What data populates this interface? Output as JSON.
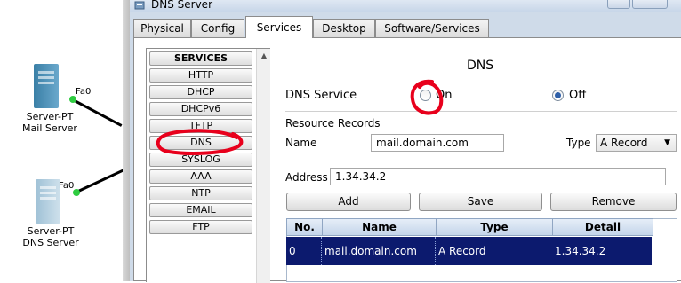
{
  "topology": {
    "nodes": [
      {
        "type_label": "Server-PT",
        "name_label": "Mail Server",
        "port": "Fa0",
        "color": "#4a8fb5"
      },
      {
        "type_label": "Server-PT",
        "name_label": "DNS Server",
        "port": "Fa0",
        "color": "#a9c8dc"
      }
    ]
  },
  "window": {
    "title": "DNS Server",
    "tabs": [
      {
        "label": "Physical",
        "active": false
      },
      {
        "label": "Config",
        "active": false
      },
      {
        "label": "Services",
        "active": true
      },
      {
        "label": "Desktop",
        "active": false
      },
      {
        "label": "Software/Services",
        "active": false
      }
    ]
  },
  "services": {
    "header": "SERVICES",
    "items": [
      "HTTP",
      "DHCP",
      "DHCPv6",
      "TFTP",
      "DNS",
      "SYSLOG",
      "AAA",
      "NTP",
      "EMAIL",
      "FTP"
    ],
    "selected": "DNS"
  },
  "dns": {
    "title": "DNS",
    "service_label": "DNS Service",
    "on_label": "On",
    "off_label": "Off",
    "service_state": "Off",
    "resource_records_label": "Resource Records",
    "name_label": "Name",
    "name_value": "mail.domain.com",
    "type_label": "Type",
    "type_value": "A Record",
    "address_label": "Address",
    "address_value": "1.34.34.2",
    "add_label": "Add",
    "save_label": "Save",
    "remove_label": "Remove"
  },
  "records_table": {
    "columns": [
      "No.",
      "Name",
      "Type",
      "Detail"
    ],
    "rows": [
      {
        "no": "0",
        "name": "mail.domain.com",
        "type": "A Record",
        "detail": "1.34.34.2"
      }
    ],
    "selected_row_color": "#0c1a6e"
  },
  "colors": {
    "annotation": "#e8001c",
    "link_up": "#2ecc40"
  }
}
